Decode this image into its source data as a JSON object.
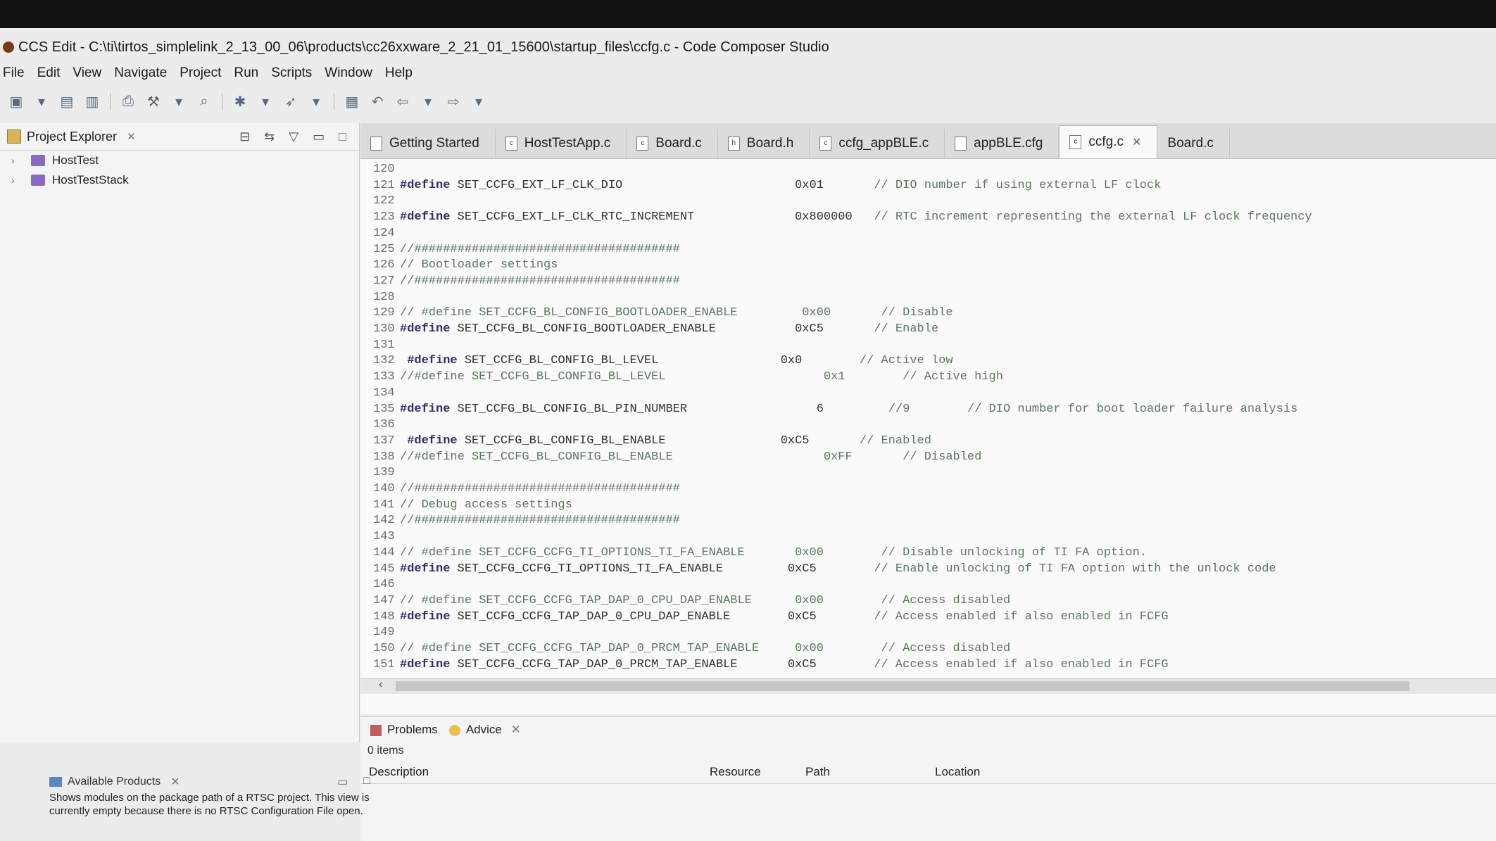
{
  "window": {
    "title": "CCS Edit - C:\\ti\\tirtos_simplelink_2_13_00_06\\products\\cc26xxware_2_21_01_15600\\startup_files\\ccfg.c - Code Composer Studio"
  },
  "menu": [
    "File",
    "Edit",
    "View",
    "Navigate",
    "Project",
    "Run",
    "Scripts",
    "Window",
    "Help"
  ],
  "project_explorer": {
    "title": "Project Explorer",
    "items": [
      "HostTest",
      "HostTestStack"
    ]
  },
  "editor_tabs": [
    {
      "label": "Getting Started",
      "icon": "welcome-icon"
    },
    {
      "label": "HostTestApp.c",
      "icon": "c-file-icon"
    },
    {
      "label": "Board.c",
      "icon": "c-file-icon"
    },
    {
      "label": "Board.h",
      "icon": "h-file-icon"
    },
    {
      "label": "ccfg_appBLE.c",
      "icon": "c-file-icon"
    },
    {
      "label": "appBLE.cfg",
      "icon": "cfg-file-icon"
    },
    {
      "label": "ccfg.c",
      "icon": "c-file-icon",
      "active": true
    },
    {
      "label": "Board.c",
      "icon": "c-file-icon"
    }
  ],
  "code_lines": [
    {
      "n": "120",
      "t": ""
    },
    {
      "n": "121",
      "t": "#define SET_CCFG_EXT_LF_CLK_DIO                        0x01       // DIO number if using external LF clock"
    },
    {
      "n": "122",
      "t": ""
    },
    {
      "n": "123",
      "t": "#define SET_CCFG_EXT_LF_CLK_RTC_INCREMENT              0x800000   // RTC increment representing the external LF clock frequency"
    },
    {
      "n": "124",
      "t": ""
    },
    {
      "n": "125",
      "t": "//#####################################"
    },
    {
      "n": "126",
      "t": "// Bootloader settings"
    },
    {
      "n": "127",
      "t": "//#####################################"
    },
    {
      "n": "128",
      "t": ""
    },
    {
      "n": "129",
      "t": "// #define SET_CCFG_BL_CONFIG_BOOTLOADER_ENABLE         0x00       // Disable"
    },
    {
      "n": "130",
      "t": "#define SET_CCFG_BL_CONFIG_BOOTLOADER_ENABLE           0xC5       // Enable"
    },
    {
      "n": "131",
      "t": ""
    },
    {
      "n": "132",
      "t": " #define SET_CCFG_BL_CONFIG_BL_LEVEL                 0x0        // Active low"
    },
    {
      "n": "133",
      "t": "//#define SET_CCFG_BL_CONFIG_BL_LEVEL                      0x1        // Active high"
    },
    {
      "n": "134",
      "t": ""
    },
    {
      "n": "135",
      "t": "#define SET_CCFG_BL_CONFIG_BL_PIN_NUMBER                  6         //9        // DIO number for boot loader failure analysis"
    },
    {
      "n": "136",
      "t": ""
    },
    {
      "n": "137",
      "t": " #define SET_CCFG_BL_CONFIG_BL_ENABLE                0xC5       // Enabled"
    },
    {
      "n": "138",
      "t": "//#define SET_CCFG_BL_CONFIG_BL_ENABLE                     0xFF       // Disabled"
    },
    {
      "n": "139",
      "t": ""
    },
    {
      "n": "140",
      "t": "//#####################################"
    },
    {
      "n": "141",
      "t": "// Debug access settings"
    },
    {
      "n": "142",
      "t": "//#####################################"
    },
    {
      "n": "143",
      "t": ""
    },
    {
      "n": "144",
      "t": "// #define SET_CCFG_CCFG_TI_OPTIONS_TI_FA_ENABLE       0x00        // Disable unlocking of TI FA option."
    },
    {
      "n": "145",
      "t": "#define SET_CCFG_CCFG_TI_OPTIONS_TI_FA_ENABLE         0xC5        // Enable unlocking of TI FA option with the unlock code"
    },
    {
      "n": "146",
      "t": ""
    },
    {
      "n": "147",
      "t": "// #define SET_CCFG_CCFG_TAP_DAP_0_CPU_DAP_ENABLE      0x00        // Access disabled"
    },
    {
      "n": "148",
      "t": "#define SET_CCFG_CCFG_TAP_DAP_0_CPU_DAP_ENABLE        0xC5        // Access enabled if also enabled in FCFG"
    },
    {
      "n": "149",
      "t": ""
    },
    {
      "n": "150",
      "t": "// #define SET_CCFG_CCFG_TAP_DAP_0_PRCM_TAP_ENABLE     0x00        // Access disabled"
    },
    {
      "n": "151",
      "t": "#define SET_CCFG_CCFG_TAP_DAP_0_PRCM_TAP_ENABLE       0xC5        // Access enabled if also enabled in FCFG"
    }
  ],
  "bottom_panel": {
    "tabs": [
      "Problems",
      "Advice"
    ],
    "count": "0 items",
    "columns": [
      "Description",
      "Resource",
      "Path",
      "Location"
    ]
  },
  "available_products": {
    "title": "Available Products",
    "text": "Shows modules on the package path of a RTSC project. This view is currently empty because there is no RTSC Configuration File open."
  }
}
